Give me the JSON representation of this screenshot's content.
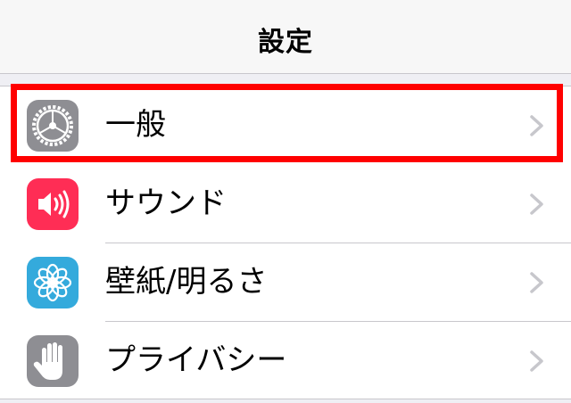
{
  "navbar": {
    "title": "設定"
  },
  "settings": {
    "items": [
      {
        "label": "一般",
        "icon": "gear-icon",
        "icon_color": "#8e8e93",
        "highlighted": true
      },
      {
        "label": "サウンド",
        "icon": "speaker-icon",
        "icon_color": "#ff2d55",
        "highlighted": false
      },
      {
        "label": "壁紙/明るさ",
        "icon": "flower-icon",
        "icon_color": "#34aadc",
        "highlighted": false
      },
      {
        "label": "プライバシー",
        "icon": "hand-icon",
        "icon_color": "#8e8e93",
        "highlighted": false
      }
    ]
  },
  "colors": {
    "highlight": "#ff0000",
    "chevron": "#c7c7cc",
    "background": "#efeff4"
  }
}
